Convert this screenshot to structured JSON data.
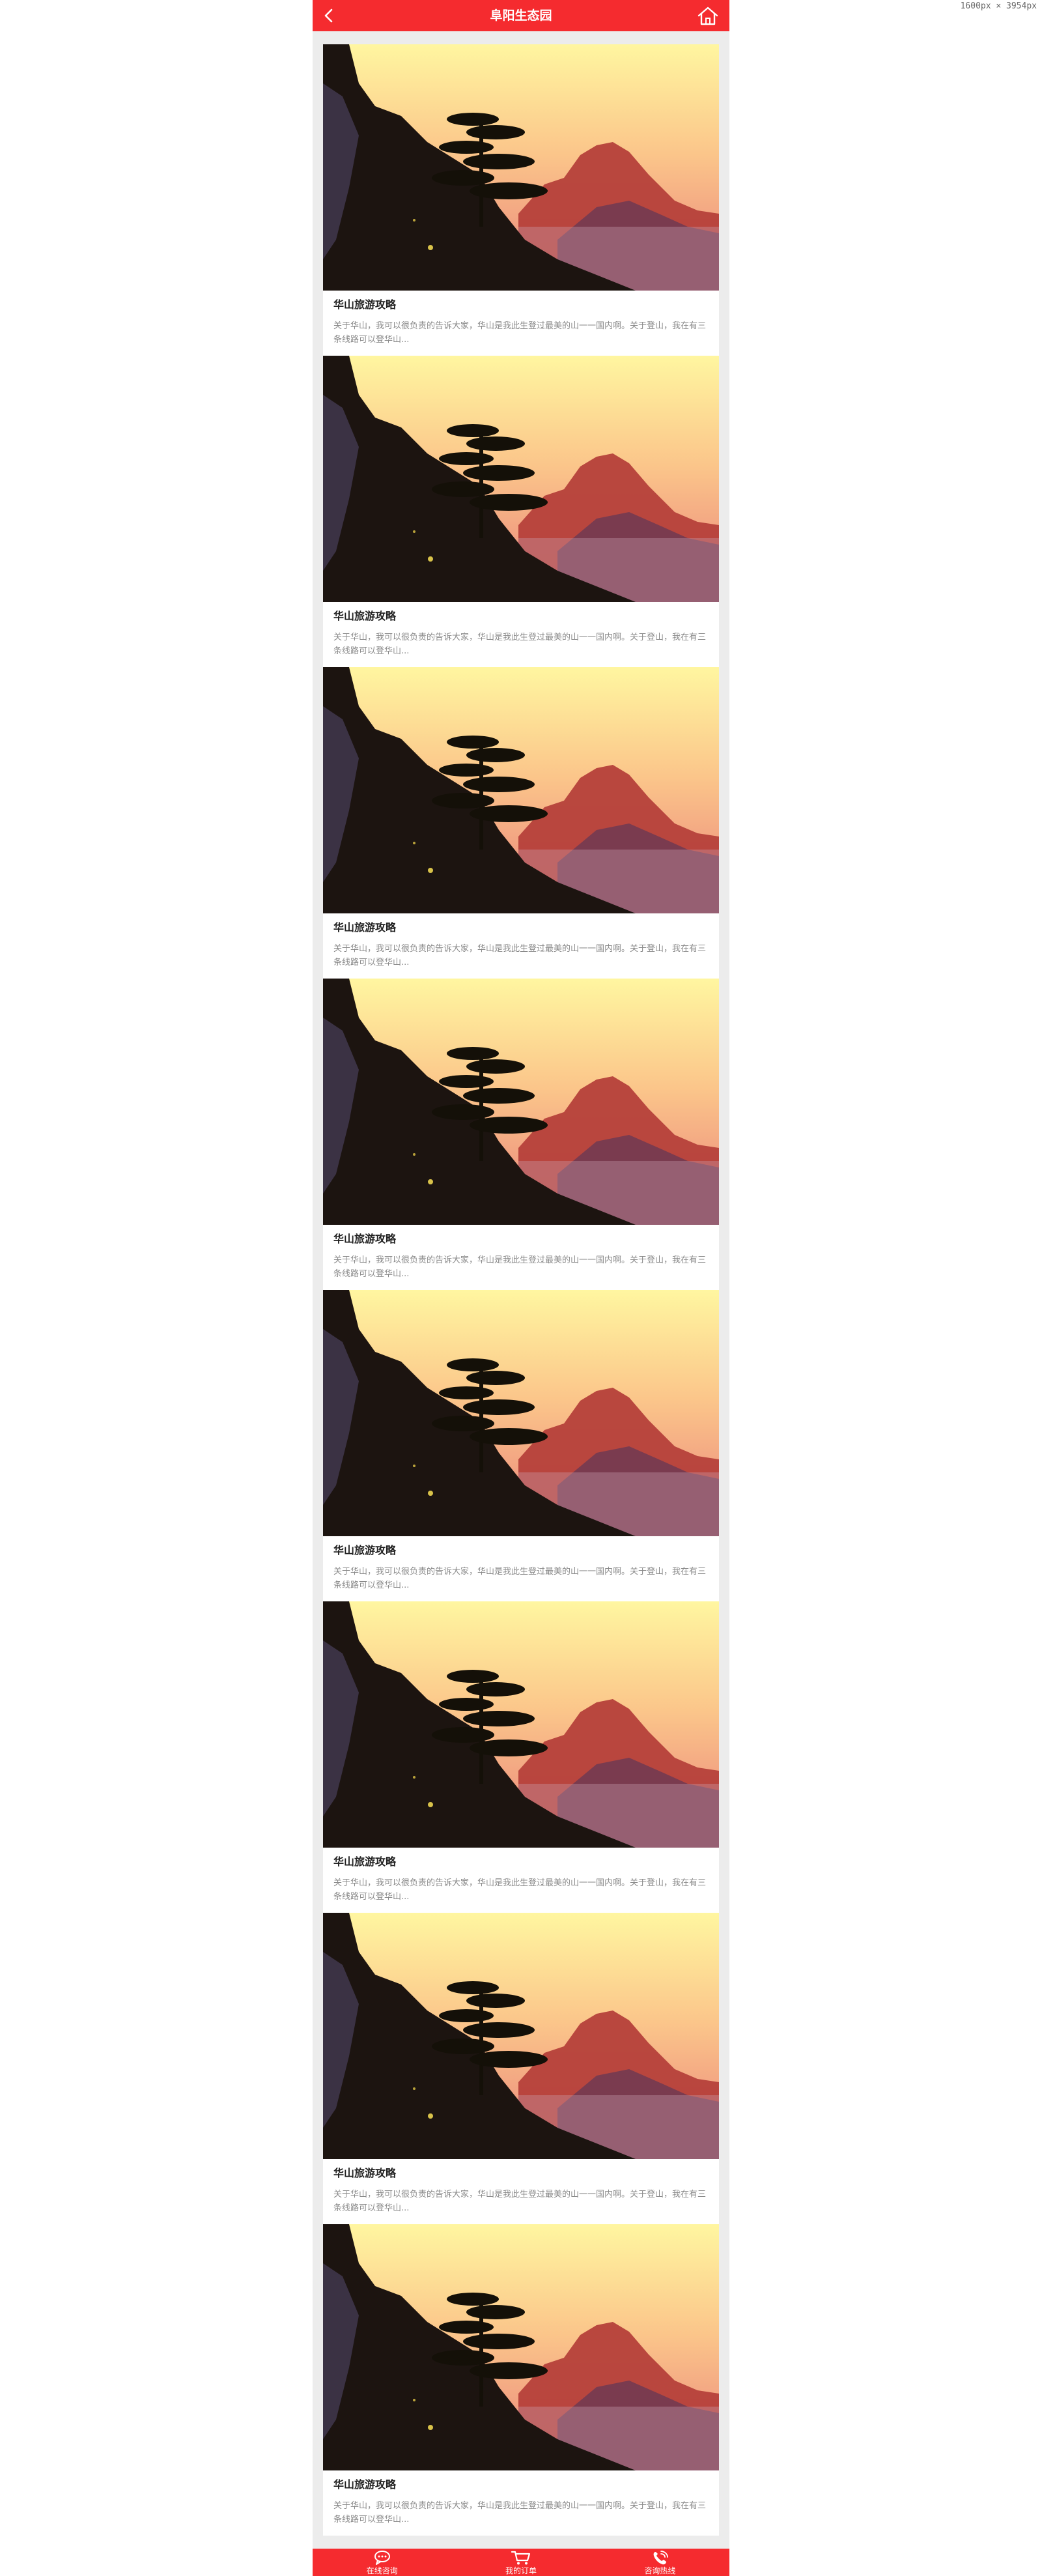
{
  "screen_size_label": "1600px × 3954px",
  "header": {
    "title": "阜阳生态园",
    "back_icon": "chevron-left-icon",
    "home_icon": "home-icon",
    "background_color": "#f52b2f"
  },
  "articles": [
    {
      "title": "华山旅游攻略",
      "summary": "关于华山，我可以很负责的告诉大家，华山是我此生登过最美的山一一国内啊。关于登山，我在有三条线路可以登华山..."
    },
    {
      "title": "华山旅游攻略",
      "summary": "关于华山，我可以很负责的告诉大家，华山是我此生登过最美的山一一国内啊。关于登山，我在有三条线路可以登华山..."
    },
    {
      "title": "华山旅游攻略",
      "summary": "关于华山，我可以很负责的告诉大家，华山是我此生登过最美的山一一国内啊。关于登山，我在有三条线路可以登华山..."
    },
    {
      "title": "华山旅游攻略",
      "summary": "关于华山，我可以很负责的告诉大家，华山是我此生登过最美的山一一国内啊。关于登山，我在有三条线路可以登华山..."
    },
    {
      "title": "华山旅游攻略",
      "summary": "关于华山，我可以很负责的告诉大家，华山是我此生登过最美的山一一国内啊。关于登山，我在有三条线路可以登华山..."
    },
    {
      "title": "华山旅游攻略",
      "summary": "关于华山，我可以很负责的告诉大家，华山是我此生登过最美的山一一国内啊。关于登山，我在有三条线路可以登华山..."
    },
    {
      "title": "华山旅游攻略",
      "summary": "关于华山，我可以很负责的告诉大家，华山是我此生登过最美的山一一国内啊。关于登山，我在有三条线路可以登华山..."
    },
    {
      "title": "华山旅游攻略",
      "summary": "关于华山，我可以很负责的告诉大家，华山是我此生登过最美的山一一国内啊。关于登山，我在有三条线路可以登华山..."
    }
  ],
  "tabbar": {
    "items": [
      {
        "label": "在线咨询",
        "icon": "chat-bubble-icon"
      },
      {
        "label": "我的订单",
        "icon": "shopping-cart-icon"
      },
      {
        "label": "咨询热线",
        "icon": "phone-call-icon"
      }
    ]
  }
}
